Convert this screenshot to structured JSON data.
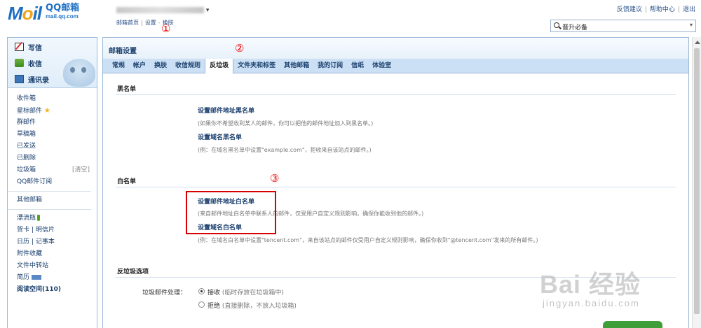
{
  "header": {
    "logo_main": "M",
    "logo_o": "o",
    "logo_il": "il",
    "logo_cn": "QQ邮箱",
    "logo_url": "mail.qq.com",
    "account_suffix": "▾",
    "links": [
      "邮箱首页",
      "设置",
      "换肤"
    ],
    "top_links": [
      "反馈建议",
      "帮助中心",
      "退出"
    ],
    "search_value": "晋升必备",
    "search_drop": "▾"
  },
  "annotations": [
    "①",
    "②",
    "③"
  ],
  "sidebar": {
    "actions": [
      "写信",
      "收信",
      "通讯录"
    ],
    "folders": [
      "收件箱",
      "星标邮件",
      "群邮件",
      "草稿箱",
      "已发送",
      "已删除",
      "垃圾箱",
      "QQ邮件订阅"
    ],
    "trash_clear": "[清空]",
    "other": "其他邮箱",
    "apps": [
      "漂流瓶",
      "贺卡",
      "明信片",
      "日历",
      "记事本",
      "附件收藏",
      "文件中转站",
      "简历",
      "阅读空间(110)"
    ],
    "pipe": "|",
    "star_glyph": "★"
  },
  "main": {
    "title": "邮箱设置",
    "tabs": [
      "常规",
      "帐户",
      "换肤",
      "收信规则",
      "反垃圾",
      "文件夹和标签",
      "其他邮箱",
      "我的订阅",
      "信纸",
      "体验室"
    ],
    "active_tab": "反垃圾",
    "blacklist": {
      "title": "黑名单",
      "addr_link": "设置邮件地址黑名单",
      "addr_hint": "(如果你不希望收到某人的邮件，你可以把他的邮件地址加入到黑名单。)",
      "domain_link": "设置域名黑名单",
      "domain_hint": "(例：在域名黑名单中设置\"example.com\"，拒收来自该站点的邮件。)"
    },
    "whitelist": {
      "title": "白名单",
      "addr_link": "设置邮件地址白名单",
      "addr_hint": "(来自邮件地址白名单中联系人的邮件，仅受用户自定义规则影响，确保你能收到他的邮件。)",
      "domain_link": "设置域名白名单",
      "domain_hint": "(例：在域名白名单中设置\"tencent.com\"，来自该站点的邮件仅受用户自定义规则影响，确保你收到\"@tencent.com\"发来的所有邮件。)"
    },
    "antispam": {
      "title": "反垃圾选项",
      "label": "垃圾邮件处理：",
      "opt_accept": "接收",
      "opt_accept_hint": "(临时存放在垃圾箱中)",
      "opt_reject": "拒绝",
      "opt_reject_hint": "(直接删除，不放入垃圾箱)",
      "selected": "接收"
    }
  },
  "watermark": {
    "main": "Bai 经验",
    "sub": "jingyan.baidu.com"
  },
  "colors": {
    "brand_blue": "#1d6fc4",
    "annotation_red": "#e00000",
    "tab_bar": "#cbe0f4"
  }
}
